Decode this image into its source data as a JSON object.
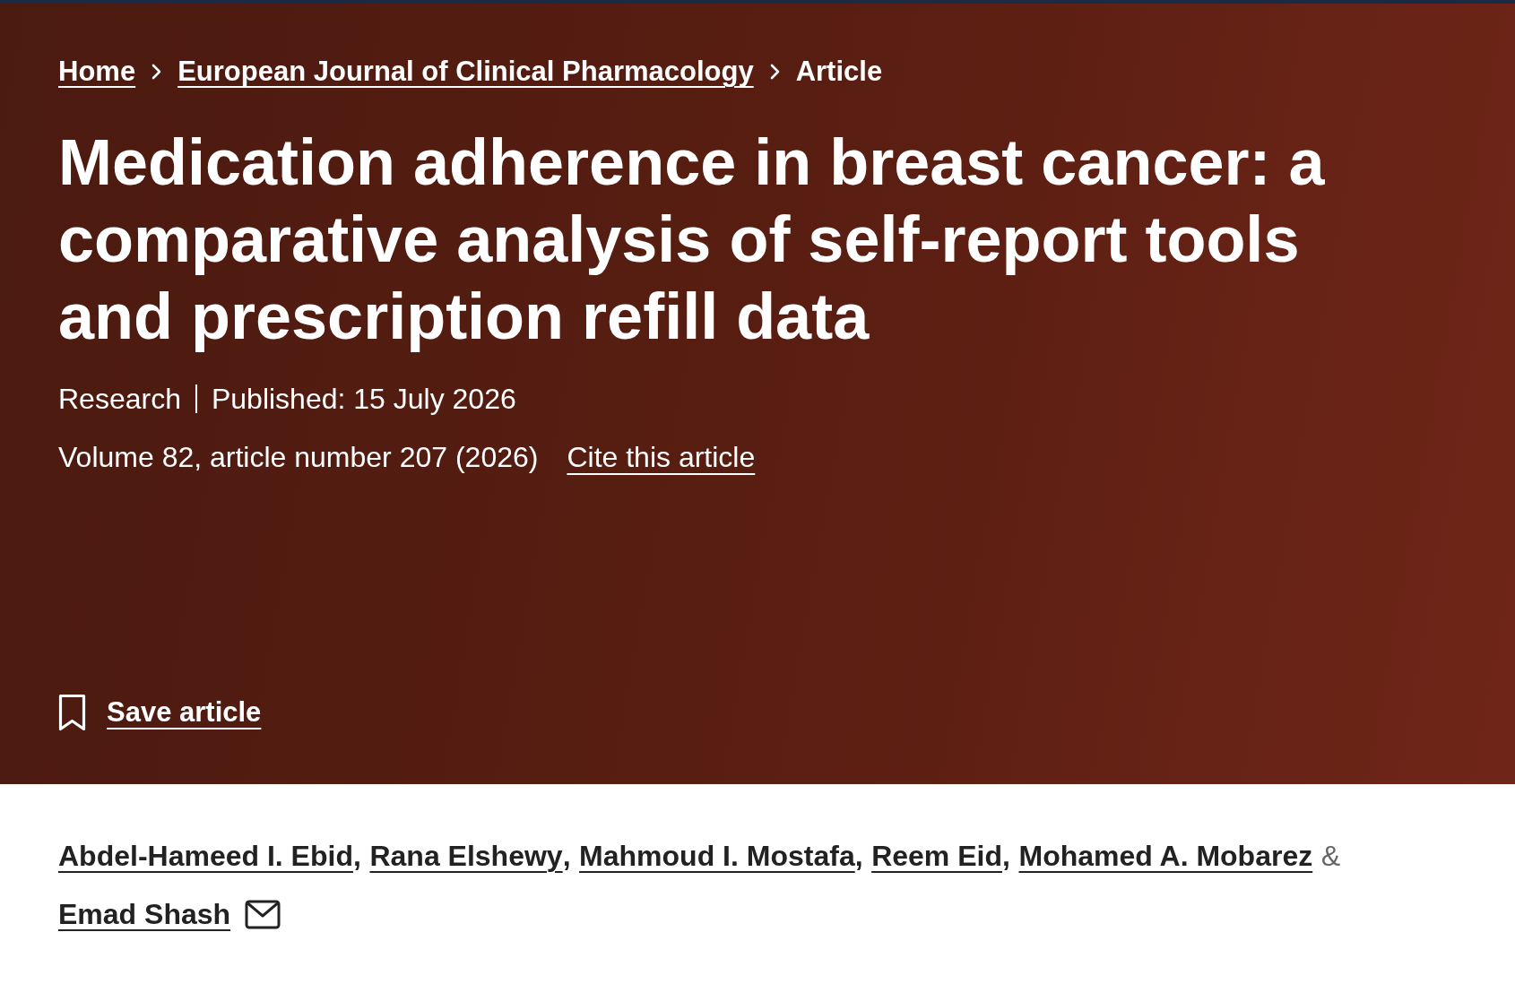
{
  "breadcrumbs": [
    {
      "label": "Home",
      "kind": "link"
    },
    {
      "label": "European Journal of Clinical Pharmacology",
      "kind": "link"
    },
    {
      "label": "Article",
      "kind": "current"
    }
  ],
  "article": {
    "title": "Medication adherence in breast cancer: a comparative analysis of self-report tools and prescription refill data",
    "article_type": "Research",
    "published": "Published: 15 July 2026",
    "citation": "Volume 82, article number 207 (2026)",
    "cite_link": "Cite this article",
    "save_button": "Save article"
  },
  "authors": [
    {
      "name": "Abdel-Hameed I. Ebid",
      "separator": {
        "text": ",",
        "kind": "comma"
      },
      "has_email": false
    },
    {
      "name": "Rana Elshewy",
      "separator": {
        "text": ",",
        "kind": "comma"
      },
      "has_email": false
    },
    {
      "name": "Mahmoud I. Mostafa",
      "separator": {
        "text": ",",
        "kind": "comma"
      },
      "has_email": false
    },
    {
      "name": "Reem Eid",
      "separator": {
        "text": ",",
        "kind": "comma"
      },
      "has_email": false
    },
    {
      "name": "Mohamed A. Mobarez",
      "separator": {
        "text": "&",
        "kind": "conjunction"
      },
      "has_email": false
    },
    {
      "name": "Emad Shash",
      "has_email": true
    }
  ]
}
